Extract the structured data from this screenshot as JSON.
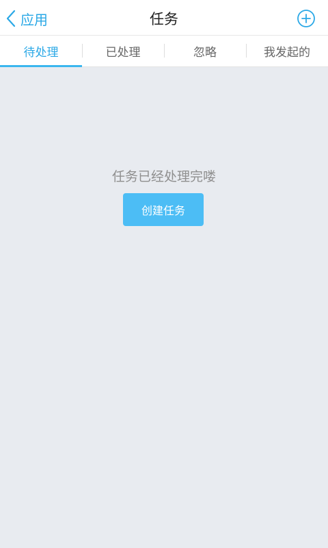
{
  "header": {
    "back_label": "应用",
    "title": "任务",
    "back_icon": "chevron-left-icon",
    "add_icon": "plus-circle-icon"
  },
  "tabs": [
    {
      "label": "待处理",
      "active": true
    },
    {
      "label": "已处理",
      "active": false
    },
    {
      "label": "忽略",
      "active": false
    },
    {
      "label": "我发起的",
      "active": false
    }
  ],
  "empty_state": {
    "message": "任务已经处理完喽",
    "create_button_label": "创建任务"
  },
  "colors": {
    "accent": "#2aa8e6",
    "button": "#4cbdf5",
    "background": "#e8ebf0"
  }
}
